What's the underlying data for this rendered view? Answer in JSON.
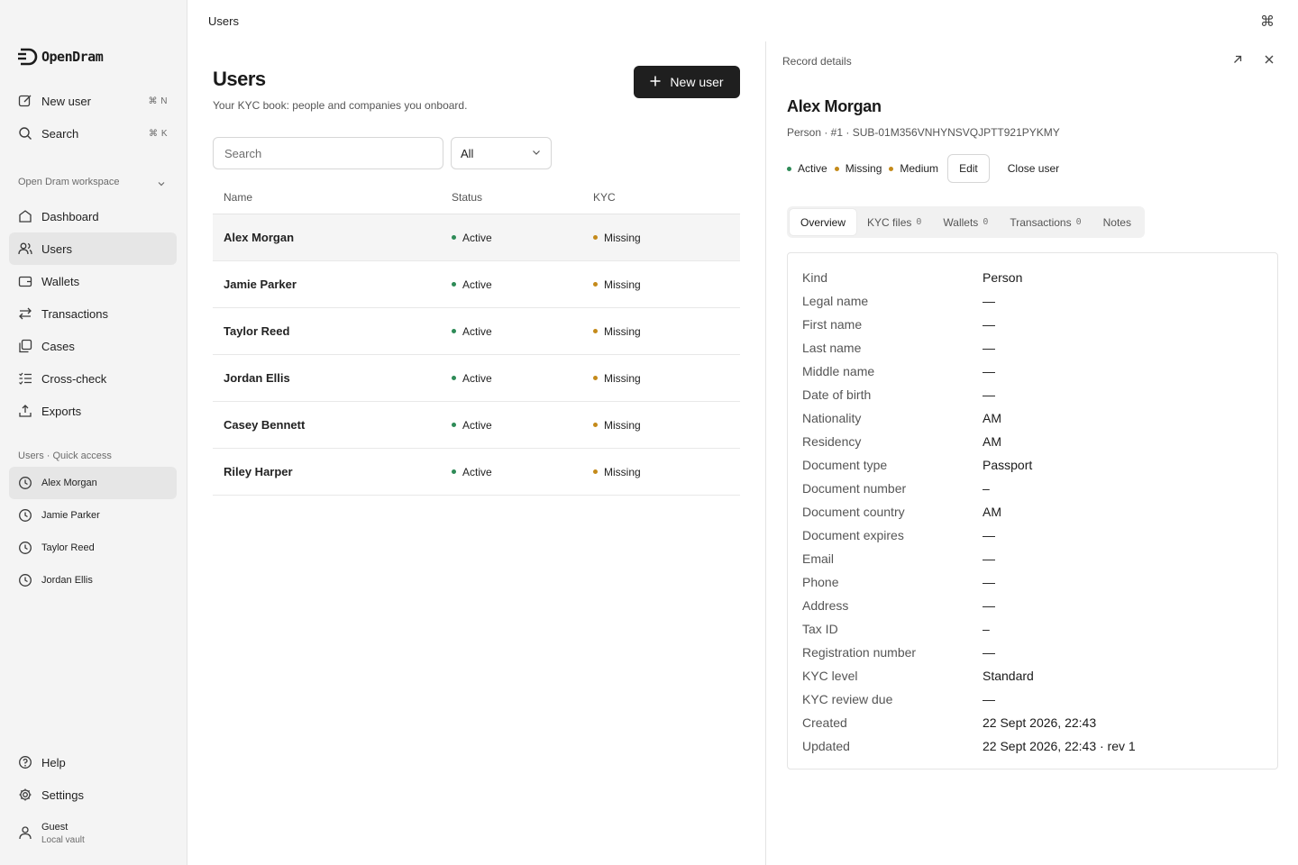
{
  "app": {
    "brand": "OpenDram",
    "topbar_title": "Users"
  },
  "sidebar": {
    "actions": [
      {
        "label": "New user",
        "shortcut": "⌘ N",
        "icon": "new-user-icon"
      },
      {
        "label": "Search",
        "shortcut": "⌘ K",
        "icon": "search-icon"
      }
    ],
    "workspace_label": "Open Dram workspace",
    "nav": [
      {
        "label": "Dashboard",
        "icon": "dashboard-icon",
        "active": false
      },
      {
        "label": "Users",
        "icon": "users-icon",
        "active": true
      },
      {
        "label": "Wallets",
        "icon": "wallet-icon",
        "active": false
      },
      {
        "label": "Transactions",
        "icon": "transactions-icon",
        "active": false
      },
      {
        "label": "Cases",
        "icon": "cases-icon",
        "active": false
      },
      {
        "label": "Cross-check",
        "icon": "cross-check-icon",
        "active": false
      },
      {
        "label": "Exports",
        "icon": "export-icon",
        "active": false
      }
    ],
    "quick_access_label": "Users · Quick access",
    "quick_access": [
      {
        "label": "Alex Morgan",
        "active": true
      },
      {
        "label": "Jamie Parker",
        "active": false
      },
      {
        "label": "Taylor Reed",
        "active": false
      },
      {
        "label": "Jordan Ellis",
        "active": false
      }
    ],
    "bottom": [
      {
        "label": "Help",
        "icon": "help-icon"
      },
      {
        "label": "Settings",
        "icon": "gear-icon"
      }
    ],
    "user": {
      "name": "Guest",
      "subtitle": "Local vault"
    }
  },
  "list": {
    "title": "Users",
    "subtitle": "Your KYC book: people and companies you onboard.",
    "new_button": "New user",
    "search_placeholder": "Search",
    "filter_value": "All",
    "columns": [
      "Name",
      "Status",
      "KYC"
    ],
    "rows": [
      {
        "name": "Alex Morgan",
        "status": "Active",
        "kyc": "Missing",
        "selected": true
      },
      {
        "name": "Jamie Parker",
        "status": "Active",
        "kyc": "Missing",
        "selected": false
      },
      {
        "name": "Taylor Reed",
        "status": "Active",
        "kyc": "Missing",
        "selected": false
      },
      {
        "name": "Jordan Ellis",
        "status": "Active",
        "kyc": "Missing",
        "selected": false
      },
      {
        "name": "Casey Bennett",
        "status": "Active",
        "kyc": "Missing",
        "selected": false
      },
      {
        "name": "Riley Harper",
        "status": "Active",
        "kyc": "Missing",
        "selected": false
      }
    ]
  },
  "details": {
    "header": "Record details",
    "name": "Alex Morgan",
    "meta": "Person · #1 · SUB-01M356VNHYNSVQJPTT921PYKMY",
    "badges": [
      {
        "label": "Active",
        "color": "#2e8b57"
      },
      {
        "label": "Missing",
        "color": "#c48a1a"
      },
      {
        "label": "Medium",
        "color": "#c48a1a"
      }
    ],
    "edit_button": "Edit",
    "close_button": "Close user",
    "tabs": [
      {
        "label": "Overview",
        "count": "",
        "active": true
      },
      {
        "label": "KYC files",
        "count": "0",
        "active": false
      },
      {
        "label": "Wallets",
        "count": "0",
        "active": false
      },
      {
        "label": "Transactions",
        "count": "0",
        "active": false
      },
      {
        "label": "Notes",
        "count": "",
        "active": false
      }
    ],
    "fields": [
      {
        "label": "Kind",
        "value": "Person"
      },
      {
        "label": "Legal name",
        "value": "—"
      },
      {
        "label": "First name",
        "value": "—"
      },
      {
        "label": "Last name",
        "value": "—"
      },
      {
        "label": "Middle name",
        "value": "—"
      },
      {
        "label": "Date of birth",
        "value": "—"
      },
      {
        "label": "Nationality",
        "value": "AM"
      },
      {
        "label": "Residency",
        "value": "AM"
      },
      {
        "label": "Document type",
        "value": "Passport"
      },
      {
        "label": "Document number",
        "value": "–"
      },
      {
        "label": "Document country",
        "value": "AM"
      },
      {
        "label": "Document expires",
        "value": "—"
      },
      {
        "label": "Email",
        "value": "—"
      },
      {
        "label": "Phone",
        "value": "—"
      },
      {
        "label": "Address",
        "value": "—"
      },
      {
        "label": "Tax ID",
        "value": "–"
      },
      {
        "label": "Registration number",
        "value": "—"
      },
      {
        "label": "KYC level",
        "value": "Standard"
      },
      {
        "label": "KYC review due",
        "value": "—"
      },
      {
        "label": "Created",
        "value": "22 Sept 2026, 22:43"
      },
      {
        "label": "Updated",
        "value": "22 Sept 2026, 22:43 · rev 1"
      }
    ]
  },
  "colors": {
    "active_dot": "#2e8b57",
    "missing_dot": "#c48a1a",
    "primary_button": "#1f1f1f"
  }
}
